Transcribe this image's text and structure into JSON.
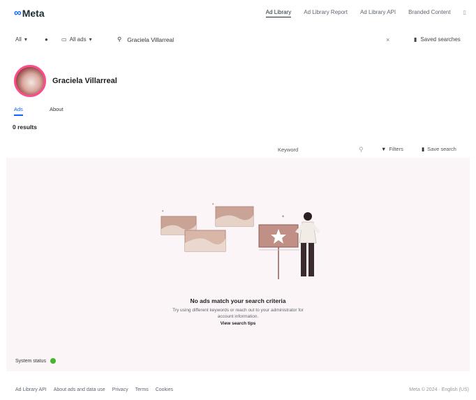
{
  "brand": {
    "logo_text": "Meta"
  },
  "top_nav": {
    "items": [
      {
        "label": "Ad Library",
        "active": true
      },
      {
        "label": "Ad Library Report",
        "active": false
      },
      {
        "label": "Ad Library API",
        "active": false
      },
      {
        "label": "Branded Content",
        "active": false
      }
    ]
  },
  "filter_bar": {
    "country": "All",
    "ad_category": "All ads",
    "search_query": "Graciela Villarreal",
    "clear_label": "×",
    "saved_searches": "Saved searches"
  },
  "profile": {
    "name": "Graciela Villarreal"
  },
  "tabs": [
    {
      "label": "Ads",
      "active": true
    },
    {
      "label": "About",
      "active": false
    }
  ],
  "results_label": "0 results",
  "results_bar": {
    "keyword_placeholder": "Keyword",
    "filters_label": "Filters",
    "save_search_label": "Save search"
  },
  "empty_state": {
    "title": "No ads match your search criteria",
    "body": "Try using different keywords or reach out to your administrator for account information.",
    "link": "View search tips"
  },
  "system_status": {
    "label": "System status",
    "color": "#42b72a"
  },
  "footer": {
    "links": [
      "Ad Library API",
      "About ads and data use",
      "Privacy",
      "Terms",
      "Cookies"
    ],
    "right": "Meta © 2024 · English (US)"
  },
  "colors": {
    "accent": "#0866ff",
    "panel_bg": "#fbf5f8",
    "avatar_ring": "#ff4b8b"
  }
}
